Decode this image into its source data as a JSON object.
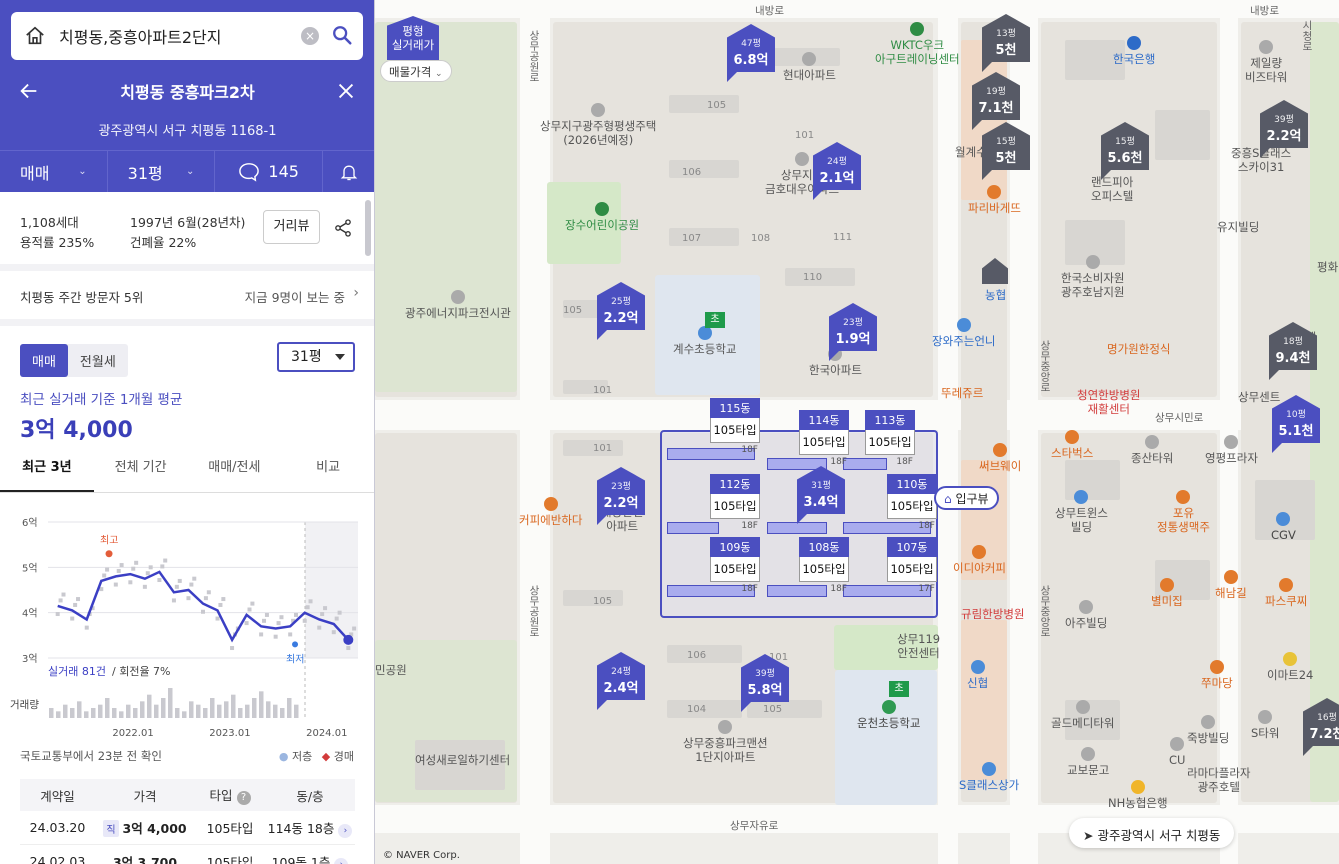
{
  "search": {
    "value": "치평동,중흥아파트2단지",
    "clear": "×"
  },
  "header": {
    "title": "치평동 중흥파크2차",
    "address": "광주광역시 서구 치평동 1168-1"
  },
  "tabs": {
    "trade_type": "매매",
    "size": "31평",
    "comments": "145"
  },
  "info": {
    "households": "1,108세대",
    "floor_area_ratio": "용적률 235%",
    "built": "1997년 6월(28년차)",
    "coverage": "건폐율 22%",
    "street_view": "거리뷰"
  },
  "visitor": {
    "weekly": "치평동 주간 방문자 5위",
    "now": "지금 9명이 보는 중"
  },
  "trade": {
    "seg_sale": "매매",
    "seg_rent": "전월세",
    "size_select": "31평",
    "avg_label": "최근 실거래 기준 1개월 평균",
    "avg_price": "3억 4,000"
  },
  "period_tabs": [
    "최근 3년",
    "전체 기간",
    "매매/전세",
    "비교"
  ],
  "chart_data": {
    "type": "line",
    "title": "",
    "ylabel": "",
    "y_ticks": [
      "6억",
      "5억",
      "4억",
      "3억"
    ],
    "ylim": [
      3,
      6
    ],
    "x_ticks": [
      "2022.01",
      "2023.01",
      "2024.01"
    ],
    "x": [
      2021.25,
      2021.4,
      2021.55,
      2021.7,
      2021.85,
      2022.0,
      2022.15,
      2022.3,
      2022.45,
      2022.6,
      2022.75,
      2022.9,
      2023.05,
      2023.2,
      2023.35,
      2023.5,
      2023.65,
      2023.8,
      2023.95,
      2024.1,
      2024.25
    ],
    "values": [
      4.15,
      4.05,
      3.85,
      4.7,
      4.8,
      4.85,
      4.75,
      4.9,
      4.45,
      4.5,
      4.2,
      4.05,
      3.4,
      3.95,
      3.7,
      3.65,
      3.7,
      4.0,
      3.85,
      3.75,
      3.4
    ],
    "high_label": "최고",
    "low_label": "최저",
    "stats_count": "실거래 81건",
    "stats_turnover": "/ 회전율 7%",
    "volume_label": "거래량",
    "volume": [
      3,
      2,
      4,
      3,
      5,
      2,
      3,
      4,
      6,
      3,
      2,
      4,
      3,
      5,
      7,
      4,
      6,
      9,
      3,
      2,
      5,
      4,
      3,
      6,
      4,
      5,
      7,
      3,
      4,
      6,
      8,
      5,
      4,
      3,
      6,
      4
    ]
  },
  "source": {
    "text": "국토교통부에서 23분 전 확인",
    "legend_low": "저층",
    "legend_auction": "경매"
  },
  "table": {
    "headers": [
      "계약일",
      "가격",
      "타입",
      "동/층"
    ],
    "rows": [
      {
        "date": "24.03.20",
        "badge": "직",
        "price": "3억 4,000",
        "type": "105타입",
        "dong": "114동 18층"
      },
      {
        "date": "24.02.03",
        "badge": "",
        "price": "3억 3,700",
        "type": "105타입",
        "dong": "109동 1층"
      }
    ]
  },
  "map": {
    "real_trade_badge_1": "평형",
    "real_trade_badge_2": "실거래가",
    "price_type_btn": "매물가격",
    "entrance": "입구뷰",
    "location": "광주광역시 서구 치평동",
    "copyright": "© NAVER Corp.",
    "markers": [
      {
        "size": "47평",
        "price": "6.8억",
        "color": "blue"
      },
      {
        "size": "24평",
        "price": "2.1억",
        "color": "blue"
      },
      {
        "size": "25평",
        "price": "2.2억",
        "color": "blue"
      },
      {
        "size": "23평",
        "price": "1.9억",
        "color": "blue"
      },
      {
        "size": "23평",
        "price": "2.2억",
        "color": "blue"
      },
      {
        "size": "31평",
        "price": "3.4억",
        "color": "blue"
      },
      {
        "size": "24평",
        "price": "2.4억",
        "color": "blue"
      },
      {
        "size": "39평",
        "price": "5.8억",
        "color": "blue"
      },
      {
        "size": "13평",
        "price": "5천",
        "color": "gray"
      },
      {
        "size": "19평",
        "price": "7.1천",
        "color": "gray"
      },
      {
        "size": "15평",
        "price": "5천",
        "color": "gray"
      },
      {
        "size": "15평",
        "price": "5.6천",
        "color": "gray"
      },
      {
        "size": "39평",
        "price": "2.2억",
        "color": "gray"
      },
      {
        "size": "18평",
        "price": "9.4천",
        "color": "gray"
      },
      {
        "size": "10평",
        "price": "5.1천",
        "color": "blue"
      },
      {
        "size": "16평",
        "price": "7.2천",
        "color": "gray"
      }
    ],
    "dongs": [
      {
        "dong": "115동",
        "type": "105타입",
        "floor": "18F"
      },
      {
        "dong": "114동",
        "type": "105타입",
        "floor": "18F"
      },
      {
        "dong": "113동",
        "type": "105타입",
        "floor": "18F"
      },
      {
        "dong": "112동",
        "type": "105타입",
        "floor": "18F"
      },
      {
        "dong": "110동",
        "type": "105타입",
        "floor": "18F"
      },
      {
        "dong": "109동",
        "type": "105타입",
        "floor": "18F"
      },
      {
        "dong": "108동",
        "type": "105타입",
        "floor": "18F"
      },
      {
        "dong": "107동",
        "type": "105타입",
        "floor": "17F"
      }
    ],
    "pois": {
      "wktc": "WKTC우크\n아구트레이닝센터",
      "hyundai": "현대아파트",
      "sangmu_housing": "상무지구광주형평생주택\n(2026년예정)",
      "geumho": "상무지구\n금호대우아파트",
      "jangsu_park": "장수어린이공원",
      "energy": "광주에너지파크전시관",
      "gyesu_school": "계수초등학교",
      "hankook_apt": "한국아파트",
      "haegwang": "해광한신\n아파트",
      "coffee": "커피에반하다",
      "sangmu_park_mansion": "상무중흥파크맨션\n1단지아파트",
      "yeoseong": "여성새로일하기센터",
      "fire_center": "상무119\n안전센터",
      "uncheon_school": "운천초등학교",
      "paris": "파리바게뜨",
      "nonghyup": "농협",
      "jangwa": "장와주는언니",
      "ttureju": "뚜레쥬르",
      "subway": "써브웨이",
      "idiya": "이디야커피",
      "gyurim": "규림한방병원",
      "sinhyeop": "신협",
      "s_class": "S클래스상가",
      "bank_korea": "한국은행",
      "jeilryang": "제일량\n비즈타워",
      "randpia": "랜드피아\n오피스텔",
      "yuji": "유지빌딩",
      "consumer": "한국소비자원\n광주호남지원",
      "myeongga": "명가원한정식",
      "cheongyeon": "청연한방병원\n재활센터",
      "starbucks": "스타벅스",
      "jongsan": "종산타워",
      "yeongbo": "영평프라자",
      "sangmu_wins": "상무트윈스\n빌딩",
      "popo": "포유\n정통생맥주",
      "cgv": "CGV",
      "haenamgil": "해남길",
      "byeolmi": "별미집",
      "paris2": "파스쿠찌",
      "aju": "아주빌딩",
      "emart": "이마트24",
      "jjumaru": "쭈마당",
      "golden": "골드메디타워",
      "jukbang": "죽방빌딩",
      "stower": "S타워",
      "gyobo": "교보문고",
      "cu": "CU",
      "ramada": "라마다플라자\n광주호텔",
      "nh": "NH농협은행",
      "jungheung_s": "중흥S클래스\n스카이31",
      "sangmu_center": "상무센트",
      "daeho": "대에",
      "pyeonghwa": "평화",
      "wolgye": "월계수타"
    },
    "roads": {
      "naebang": "내방로",
      "naebang2": "내방로",
      "sangmu_yuro": "상무자유로",
      "sangmu_simin": "상무시민로",
      "simin_short": "민로",
      "sangmu_gongwon": "상무공원로",
      "sangmu_gongwon2": "상무공원로",
      "sangmu_jungang": "상무중앙로",
      "sangmu_jungang2": "상무중앙로",
      "sihwangno": "시청로",
      "min_park": "민공원"
    }
  }
}
